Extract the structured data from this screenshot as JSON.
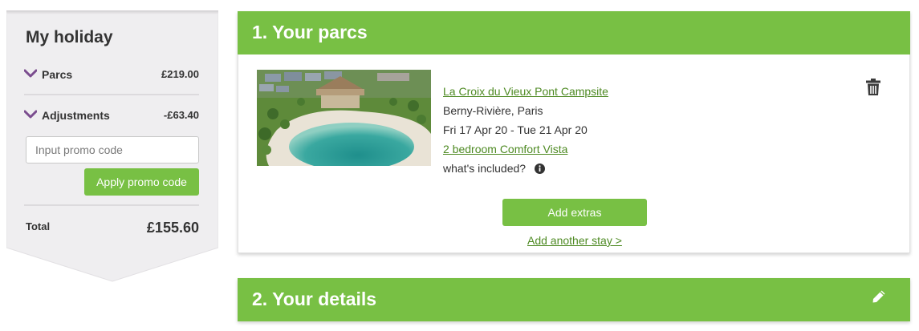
{
  "sidebar": {
    "title": "My holiday",
    "rows": [
      {
        "label": "Parcs",
        "amount": "£219.00",
        "icon": "chevron-down-icon"
      },
      {
        "label": "Adjustments",
        "amount": "-£63.40",
        "icon": "chevron-down-icon"
      }
    ],
    "promo": {
      "placeholder": "Input promo code",
      "value": "",
      "button_label": "Apply promo code"
    },
    "total": {
      "label": "Total",
      "amount": "£155.60"
    }
  },
  "sections": {
    "parcs": {
      "title": "1. Your parcs"
    },
    "details": {
      "title": "2. Your details",
      "icon": "pencil-icon"
    }
  },
  "booking": {
    "name": "La Croix du Vieux Pont Campsite",
    "location": "Berny-Rivière, Paris",
    "dates": "Fri 17 Apr 20 - Tue 21 Apr 20",
    "accommodation": "2 bedroom Comfort Vista",
    "included_label": "what's included?",
    "included_icon": "info-icon",
    "delete_icon": "trash-icon",
    "add_extras_label": "Add extras",
    "add_stay_label": "Add another stay >"
  },
  "colors": {
    "accent_green": "#78c044",
    "link_green": "#4e8a23",
    "chevron_purple": "#7b4d8f",
    "sidebar_bg": "#efeef0"
  }
}
